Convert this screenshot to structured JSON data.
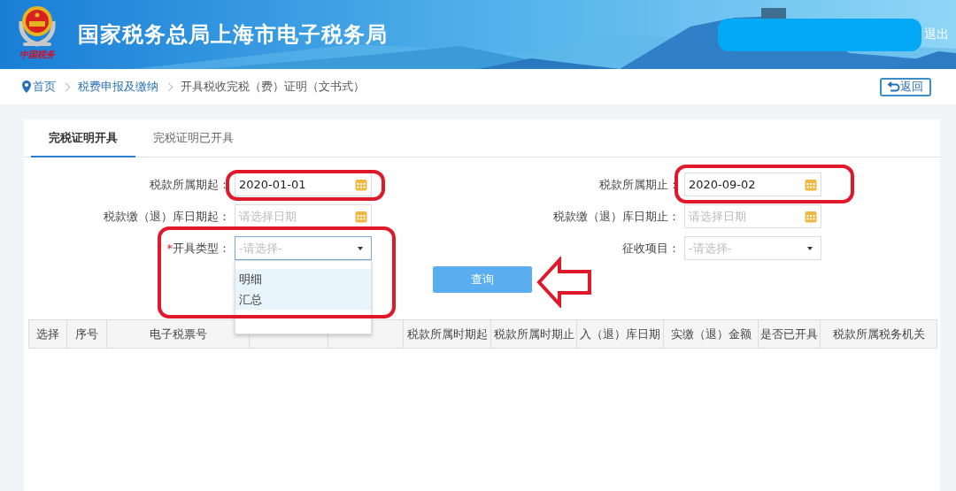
{
  "header": {
    "logo_text": "中国税务",
    "title": "国家税务总局上海市电子税务局",
    "logout": "退出"
  },
  "breadcrumb": [
    "首页",
    "税费申报及缴纳",
    "开具税收完税（费）证明（文书式）"
  ],
  "back_button": "返回",
  "tabs": [
    {
      "label": "完税证明开具",
      "selected": true
    },
    {
      "label": "完税证明已开具",
      "selected": false
    }
  ],
  "form": [
    {
      "kind": "date",
      "label": "税款所属期起：",
      "value": "2020-01-01"
    },
    {
      "kind": "date",
      "label": "税款所属期止：",
      "value": "2020-09-02"
    },
    {
      "kind": "date",
      "label": "税款缴（退）库日期起：",
      "placeholder": "请选择日期"
    },
    {
      "kind": "date",
      "label": "税款缴（退）库日期止：",
      "placeholder": "请选择日期"
    },
    {
      "kind": "select",
      "marker": "*",
      "label": "开具类型：",
      "placeholder": "-请选择-",
      "expanded": true,
      "options": [
        "明细",
        "汇总"
      ]
    },
    {
      "kind": "select",
      "label": "征收项目：",
      "placeholder": "-请选择-",
      "expanded": false
    }
  ],
  "query_button": "查询",
  "table": {
    "columns": [
      "选择",
      "序号",
      "电子税票号",
      null,
      null,
      "税款所属时期起",
      "税款所属时期止",
      "入（退）库日期",
      "实缴（退）金额",
      "是否已开具",
      "税款所属税务机关"
    ]
  }
}
